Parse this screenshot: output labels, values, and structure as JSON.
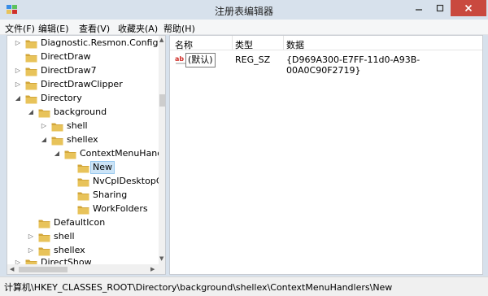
{
  "window": {
    "title": "注册表编辑器"
  },
  "menu": [
    "文件(F)",
    "编辑(E)",
    "查看(V)",
    "收藏夹(A)",
    "帮助(H)"
  ],
  "tree": [
    {
      "label": "Diagnostic.Resmon.Config",
      "expander": "▷"
    },
    {
      "label": "DirectDraw",
      "expander": ""
    },
    {
      "label": "DirectDraw7",
      "expander": "▷"
    },
    {
      "label": "DirectDrawClipper",
      "expander": "▷"
    },
    {
      "label": "Directory",
      "expander": "◢"
    },
    {
      "label": "background",
      "expander": "◢"
    },
    {
      "label": "shell",
      "expander": "▷"
    },
    {
      "label": "shellex",
      "expander": "◢"
    },
    {
      "label": "ContextMenuHand",
      "expander": "◢"
    },
    {
      "label": "New",
      "expander": "",
      "selected": true
    },
    {
      "label": "NvCplDesktopC",
      "expander": ""
    },
    {
      "label": "Sharing",
      "expander": ""
    },
    {
      "label": "WorkFolders",
      "expander": ""
    },
    {
      "label": "DefaultIcon",
      "expander": ""
    },
    {
      "label": "shell",
      "expander": "▷"
    },
    {
      "label": "shellex",
      "expander": "▷"
    },
    {
      "label": "DirectShow",
      "expander": "▷"
    }
  ],
  "list": {
    "columns": [
      "名称",
      "类型",
      "数据"
    ],
    "rows": [
      {
        "name": "(默认)",
        "type": "REG_SZ",
        "data": "{D969A300-E7FF-11d0-A93B-00A0C90F2719}"
      }
    ]
  },
  "status": {
    "path": "计算机\\HKEY_CLASSES_ROOT\\Directory\\background\\shellex\\ContextMenuHandlers\\New"
  },
  "colors": {
    "folder": "#e8c35a",
    "folder_dark": "#d2a63a",
    "close": "#c9493f",
    "selection": "#cce4f7",
    "string_icon": "#d0302a"
  },
  "icons": {
    "app": "registry-editor-icon",
    "folder": "folder-icon",
    "string_value": "string-value-icon"
  }
}
